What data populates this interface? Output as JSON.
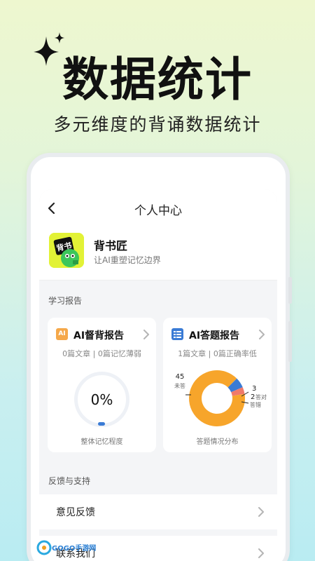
{
  "hero": {
    "title": "数据统计",
    "subtitle": "多元维度的背诵数据统计"
  },
  "nav": {
    "title": "个人中心"
  },
  "profile": {
    "avatar_text": "背书",
    "name": "背书匠",
    "slogan": "让AI重塑记忆边界"
  },
  "report_section": {
    "label": "学习报告"
  },
  "card_supervise": {
    "icon_text": "AI",
    "title": "AI督背报告",
    "stats": "0篇文章 | 0篇记忆薄弱",
    "progress_percent": 0,
    "progress_label": "0%",
    "footer": "整体记忆程度"
  },
  "card_answer": {
    "title": "AI答题报告",
    "stats": "1篇文章 | 0篇正确率低",
    "donut": {
      "unanswered_value": "45",
      "unanswered_label": "未答",
      "correct_value": "3",
      "correct_label": "答对",
      "wrong_value": "2",
      "wrong_label": "答错",
      "segments": [
        45,
        3,
        2
      ]
    },
    "footer": "答题情况分布"
  },
  "feedback_section": {
    "label": "反馈与支持"
  },
  "feedback_rows": [
    {
      "label": "意见反馈"
    },
    {
      "label": "联系我们"
    }
  ],
  "colors": {
    "donut_orange": "#f7a52b",
    "donut_blue": "#3a7bd5",
    "donut_red": "#f07a6a",
    "progress_blue": "#3a7bd5",
    "avatar_bg": "#e2f236"
  },
  "watermark": {
    "text": "GOGO手游网"
  }
}
